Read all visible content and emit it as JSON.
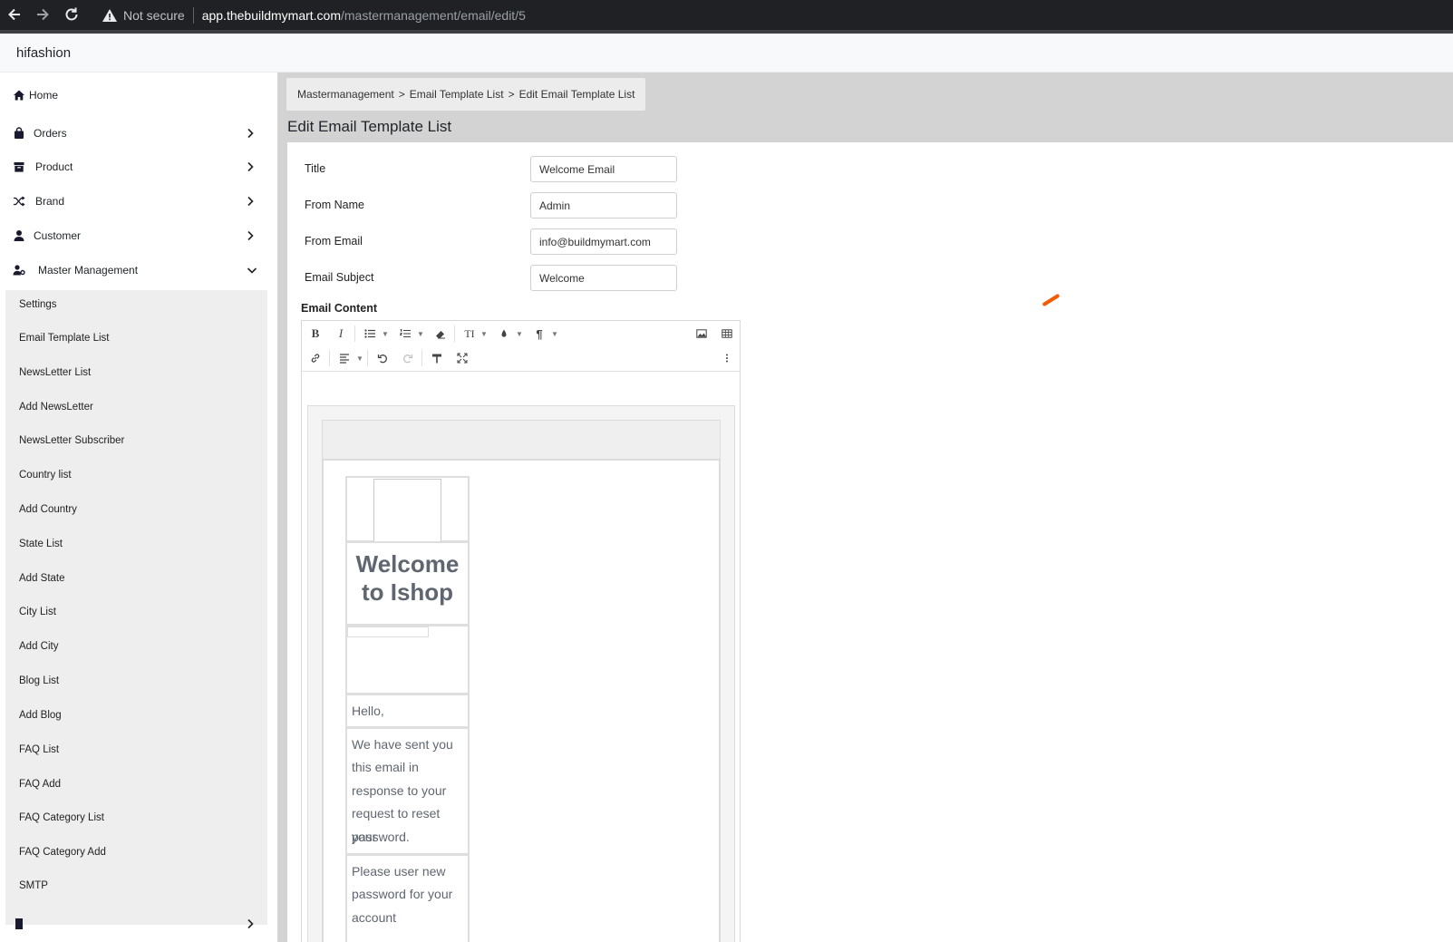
{
  "browser": {
    "security_label": "Not secure",
    "url_host": "app.thebuildmymart.com",
    "url_path": "/mastermanagement/email/edit/5"
  },
  "app": {
    "brand": "hifashion"
  },
  "sidebar": {
    "items": [
      {
        "label": "Home",
        "icon": "home-icon"
      },
      {
        "label": "Orders",
        "icon": "bag-icon"
      },
      {
        "label": "Product",
        "icon": "archive-icon"
      },
      {
        "label": "Brand",
        "icon": "shuffle-icon"
      },
      {
        "label": "Customer",
        "icon": "user-icon"
      },
      {
        "label": "Master Management",
        "icon": "user-gear-icon"
      }
    ],
    "submenu": [
      "Settings",
      "Email Template List",
      "NewsLetter List",
      "Add NewsLetter",
      "NewsLetter Subscriber",
      "Country list",
      "Add Country",
      "State List",
      "Add State",
      "City List",
      "Add City",
      "Blog List",
      "Add Blog",
      "FAQ List",
      "FAQ Add",
      "FAQ Category List",
      "FAQ Category Add",
      "SMTP"
    ]
  },
  "breadcrumb": {
    "parts": [
      "Mastermanagement",
      "Email Template List",
      "Edit Email Template List"
    ],
    "separator": ">"
  },
  "page": {
    "title": "Edit Email Template List"
  },
  "form": {
    "title_label": "Title",
    "title_value": "Welcome Email",
    "from_name_label": "From Name",
    "from_name_value": "Admin",
    "from_email_label": "From Email",
    "from_email_value": "info@buildmymart.com",
    "subject_label": "Email Subject",
    "subject_value": "Welcome",
    "content_label": "Email Content"
  },
  "email_preview": {
    "heading_line1": "Welcome",
    "heading_line2": "to Ishop",
    "greeting": "Hello,",
    "paragraph1_lines": [
      "We have sent you",
      "this email in",
      "response to your",
      "request to reset your",
      "password."
    ],
    "paragraph2_lines": [
      "Please user new",
      "password for your",
      "account"
    ]
  },
  "colors": {
    "accent_loader": "#f25c05",
    "main_bg": "#d3d3d3",
    "submenu_bg": "#eeeeee"
  }
}
